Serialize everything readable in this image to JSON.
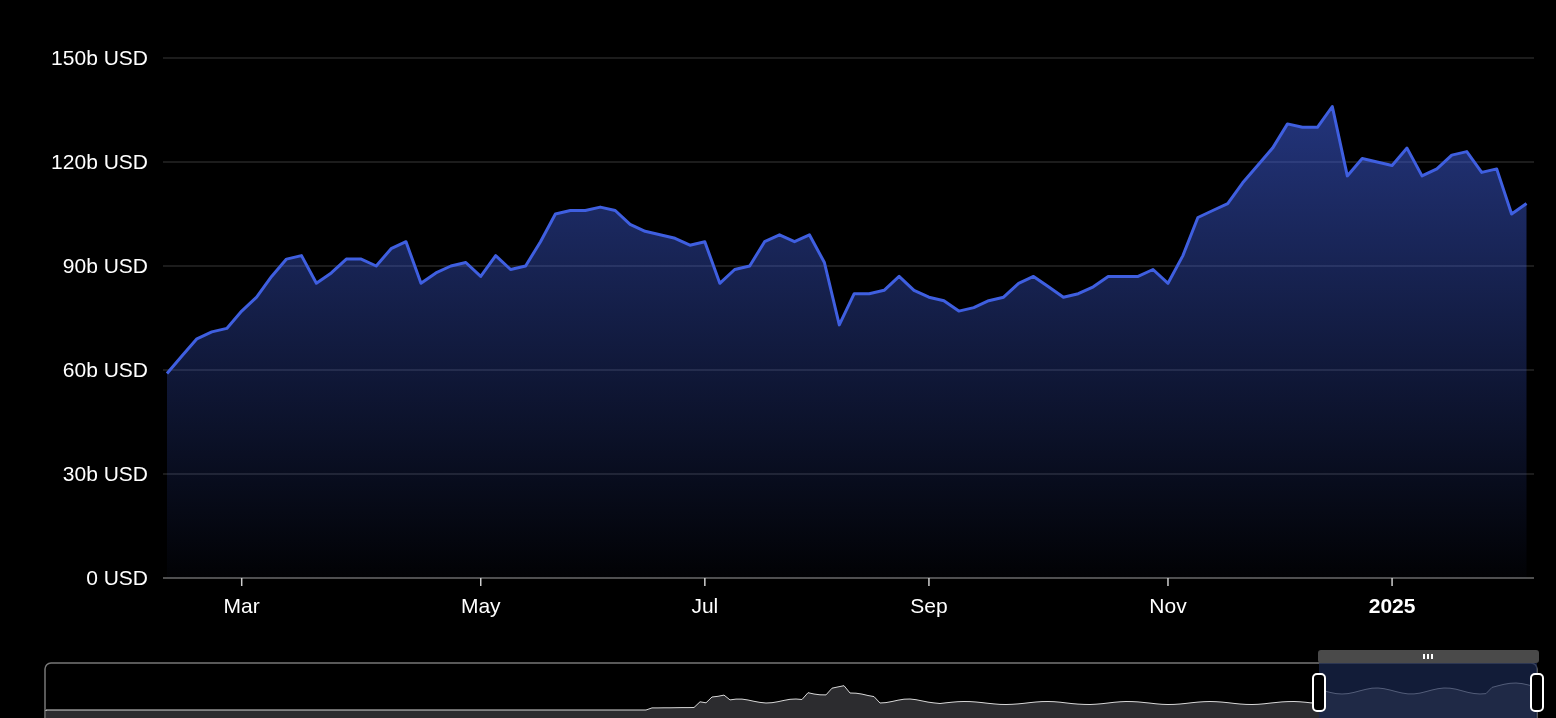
{
  "chart": {
    "chart_data": {
      "type": "area",
      "categories": [
        null,
        null,
        null,
        null,
        null,
        "Mar",
        null,
        null,
        null,
        null,
        null,
        null,
        null,
        null,
        null,
        null,
        null,
        null,
        null,
        null,
        null,
        "May",
        null,
        null,
        null,
        null,
        null,
        null,
        null,
        null,
        null,
        null,
        null,
        null,
        null,
        null,
        "Jul",
        null,
        null,
        null,
        null,
        null,
        null,
        null,
        null,
        null,
        null,
        null,
        null,
        null,
        null,
        "Sep",
        null,
        null,
        null,
        null,
        null,
        null,
        null,
        null,
        null,
        null,
        null,
        null,
        null,
        null,
        null,
        "Nov",
        null,
        null,
        null,
        null,
        null,
        null,
        null,
        null,
        null,
        null,
        null,
        null,
        null,
        null,
        "2025",
        null,
        null,
        null,
        null,
        null,
        null,
        null,
        null,
        null
      ],
      "series": [
        {
          "color": "#3f5fe0",
          "values": [
            59,
            64,
            69,
            71,
            72,
            77,
            81,
            87,
            92,
            93,
            85,
            88,
            92,
            92,
            90,
            95,
            97,
            85,
            88,
            90,
            91,
            87,
            93,
            89,
            90,
            97,
            105,
            106,
            106,
            107,
            106,
            102,
            100,
            99,
            98,
            96,
            97,
            85,
            89,
            90,
            97,
            99,
            97,
            99,
            91,
            73,
            82,
            82,
            83,
            87,
            83,
            81,
            80,
            77,
            78,
            80,
            81,
            85,
            87,
            84,
            81,
            82,
            84,
            87,
            87,
            87,
            89,
            85,
            93,
            104,
            106,
            108,
            114,
            119,
            124,
            131,
            130,
            130,
            136,
            116,
            121,
            120,
            119,
            124,
            116,
            118,
            122,
            123,
            117,
            118,
            105,
            108
          ]
        }
      ],
      "ylim": [
        0,
        150
      ],
      "grid": true,
      "yticks": [
        {
          "value": 0,
          "label": "0 USD"
        },
        {
          "value": 30,
          "label": "30b USD"
        },
        {
          "value": 60,
          "label": "60b USD"
        },
        {
          "value": 90,
          "label": "90b USD"
        },
        {
          "value": 120,
          "label": "120b USD"
        },
        {
          "value": 150,
          "label": "150b USD"
        }
      ]
    }
  }
}
